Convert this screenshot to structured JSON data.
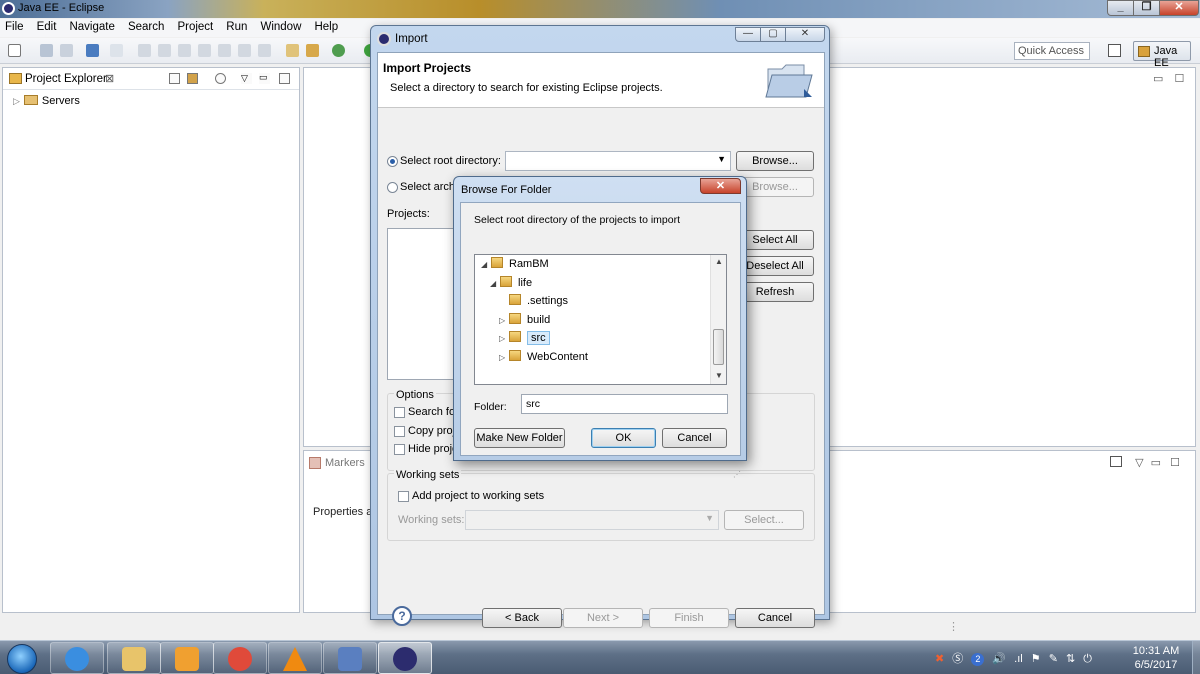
{
  "window": {
    "title": "Java EE - Eclipse"
  },
  "menu": [
    "File",
    "Edit",
    "Navigate",
    "Search",
    "Project",
    "Run",
    "Window",
    "Help"
  ],
  "toolbar": {
    "quick_access_placeholder": "Quick Access",
    "perspective_label": "Java EE"
  },
  "project_explorer": {
    "title": "Project Explorer",
    "close_glyph": "⊠",
    "tree": [
      {
        "label": "Servers",
        "expanded": false
      }
    ]
  },
  "bottom_panel": {
    "markers_tab": "Markers",
    "properties_text": "Properties ar"
  },
  "import_dialog": {
    "title": "Import",
    "header_title": "Import Projects",
    "header_subtitle": "Select a directory to search for existing Eclipse projects.",
    "select_root_label": "Select root directory:",
    "select_root_value": "",
    "select_archive_label": "Select archive file:",
    "browse_label": "Browse...",
    "projects_label": "Projects:",
    "select_all_label": "Select All",
    "deselect_all_label": "Deselect All",
    "refresh_label": "Refresh",
    "options_label": "Options",
    "option_search_nested": "Search for",
    "option_copy": "Copy proj",
    "option_hide": "Hide proje",
    "working_sets_group": "Working sets",
    "add_to_working_sets": "Add project to working sets",
    "working_sets_label": "Working sets:",
    "select_label": "Select...",
    "back_label": "< Back",
    "next_label": "Next >",
    "finish_label": "Finish",
    "cancel_label": "Cancel",
    "help_glyph": "?"
  },
  "browse_dialog": {
    "title": "Browse For Folder",
    "close_glyph": "✕",
    "description": "Select root directory of the projects to import",
    "tree": [
      {
        "label": "RamBM",
        "level": 0,
        "twisty": "◢",
        "selected": false
      },
      {
        "label": "life",
        "level": 1,
        "twisty": "◢",
        "selected": false
      },
      {
        "label": ".settings",
        "level": 2,
        "twisty": "",
        "selected": false
      },
      {
        "label": "build",
        "level": 2,
        "twisty": "▷",
        "selected": false
      },
      {
        "label": "src",
        "level": 2,
        "twisty": "▷",
        "selected": true
      },
      {
        "label": "WebContent",
        "level": 2,
        "twisty": "▷",
        "selected": false
      }
    ],
    "folder_label": "Folder:",
    "folder_value": "src",
    "make_new_folder_label": "Make New Folder",
    "ok_label": "OK",
    "cancel_label": "Cancel"
  },
  "taskbar": {
    "apps": [
      {
        "name": "internet-explorer",
        "color": "#3a8ee0"
      },
      {
        "name": "file-explorer",
        "color": "#e8c46a"
      },
      {
        "name": "media-player",
        "color": "#f0a030"
      },
      {
        "name": "chrome",
        "color": "#e04a3a"
      },
      {
        "name": "vlc",
        "color": "#f08a10"
      },
      {
        "name": "remote-desktop",
        "color": "#5a7fc0"
      },
      {
        "name": "eclipse",
        "color": "#2c2c6e"
      }
    ],
    "tray_badge": "2",
    "clock_time": "10:31 AM",
    "clock_date": "6/5/2017"
  }
}
